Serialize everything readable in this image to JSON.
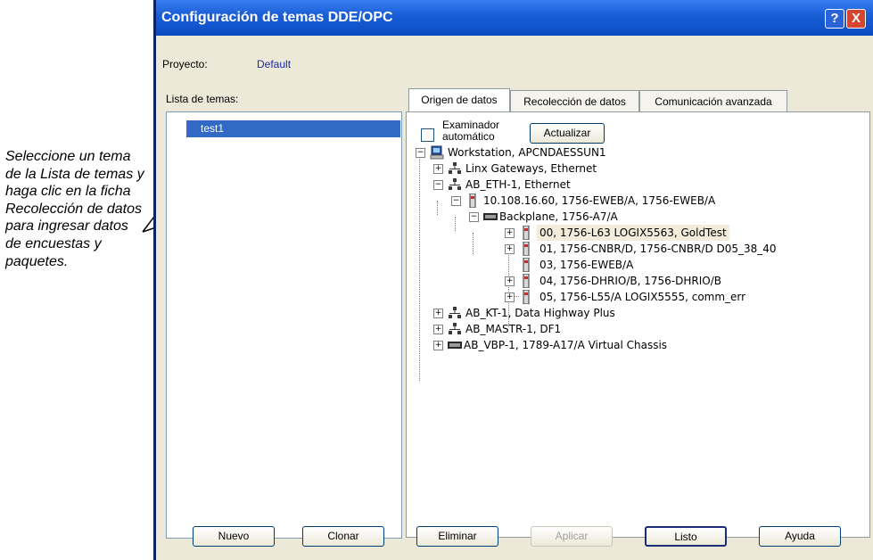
{
  "annotation": "Seleccione un tema de la Lista de temas y haga clic en la ficha Recolección de datos para ingresar datos de encuestas y paquetes.",
  "window": {
    "title": "Configuración de temas DDE/OPC",
    "help_glyph": "?",
    "close_glyph": "X"
  },
  "project": {
    "label": "Proyecto:",
    "value": "Default"
  },
  "topics": {
    "label": "Lista de temas:",
    "items": [
      "test1"
    ]
  },
  "tabs": [
    "Origen de datos",
    "Recolección de datos",
    "Comunicación avanzada"
  ],
  "browser": {
    "auto_label_line1": "Examinador",
    "auto_label_line2": "automático",
    "refresh": "Actualizar"
  },
  "tree": [
    "Workstation, APCNDAESSUN1",
    "Linx Gateways, Ethernet",
    "AB_ETH-1, Ethernet",
    "10.108.16.60, 1756-EWEB/A, 1756-EWEB/A",
    "Backplane, 1756-A7/A",
    "00, 1756-L63 LOGIX5563, GoldTest",
    "01, 1756-CNBR/D, 1756-CNBR/D D05_38_40",
    "03, 1756-EWEB/A",
    "04, 1756-DHRIO/B,  1756-DHRIO/B",
    "05, 1756-L55/A LOGIX5555, comm_err",
    "AB_KT-1, Data Highway Plus",
    "AB_MASTR-1, DF1",
    "AB_VBP-1, 1789-A17/A Virtual Chassis"
  ],
  "buttons": {
    "new": "Nuevo",
    "clone": "Clonar",
    "delete": "Eliminar",
    "apply": "Aplicar",
    "done": "Listo",
    "help": "Ayuda"
  },
  "expander": {
    "plus": "+",
    "minus": "−"
  }
}
